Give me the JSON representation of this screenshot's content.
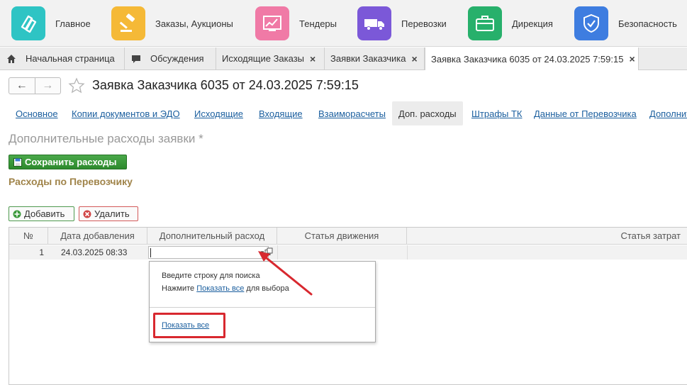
{
  "apps": [
    {
      "label": "Главное",
      "color": "#2ec4c4",
      "icon": "logo-icon"
    },
    {
      "label": "Заказы, Аукционы",
      "color": "#f5b937",
      "icon": "gavel-icon"
    },
    {
      "label": "Тендеры",
      "color": "#f07aa6",
      "icon": "chart-icon"
    },
    {
      "label": "Перевозки",
      "color": "#7b58d8",
      "icon": "truck-icon"
    },
    {
      "label": "Дирекция",
      "color": "#27b06b",
      "icon": "briefcase-icon"
    },
    {
      "label": "Безопасность",
      "color": "#3e7de0",
      "icon": "shield-icon"
    }
  ],
  "open_tabs": [
    {
      "label": "Начальная страница",
      "icon": "home-icon"
    },
    {
      "label": "Обсуждения",
      "icon": "chat-icon"
    },
    {
      "label": "Исходящие Заказы",
      "close": "×"
    },
    {
      "label": "Заявки Заказчика",
      "close": "×"
    },
    {
      "label": "Заявка Заказчика 6035 от 24.03.2025 7:59:15",
      "close": "×"
    }
  ],
  "header": {
    "back": "←",
    "forward": "→",
    "title": "Заявка Заказчика 6035 от 24.03.2025 7:59:15"
  },
  "section_tabs": [
    "Основное",
    "Копии документов и ЭДО",
    "Исходящие",
    "Входящие",
    "Взаиморасчеты",
    "Доп. расходы",
    "Штрафы ТК",
    "Данные от Перевозчика",
    "Дополнит"
  ],
  "form": {
    "title": "Дополнительные расходы заявки *",
    "save_label": "Сохранить расходы",
    "carrier_title": "Расходы по Перевозчику",
    "add_label": "Добавить",
    "delete_label": "Удалить"
  },
  "table": {
    "columns": [
      "№",
      "Дата добавления",
      "Дополнительный расход",
      "Статья движения",
      "Статья затрат"
    ],
    "rows": [
      {
        "num": "1",
        "date": "24.03.2025 08:33",
        "expense": "",
        "movement": "",
        "cost": ""
      }
    ]
  },
  "popup": {
    "line1": "Введите строку для поиска",
    "line2_prefix": "Нажмите ",
    "line2_link": "Показать все",
    "line2_suffix": " для выбора",
    "show_all": "Показать все"
  },
  "colors": {
    "link": "#1a5e9e",
    "save_green": "#2d8a2d",
    "carrier_title": "#a0844a",
    "highlight_red": "#d8282f"
  }
}
